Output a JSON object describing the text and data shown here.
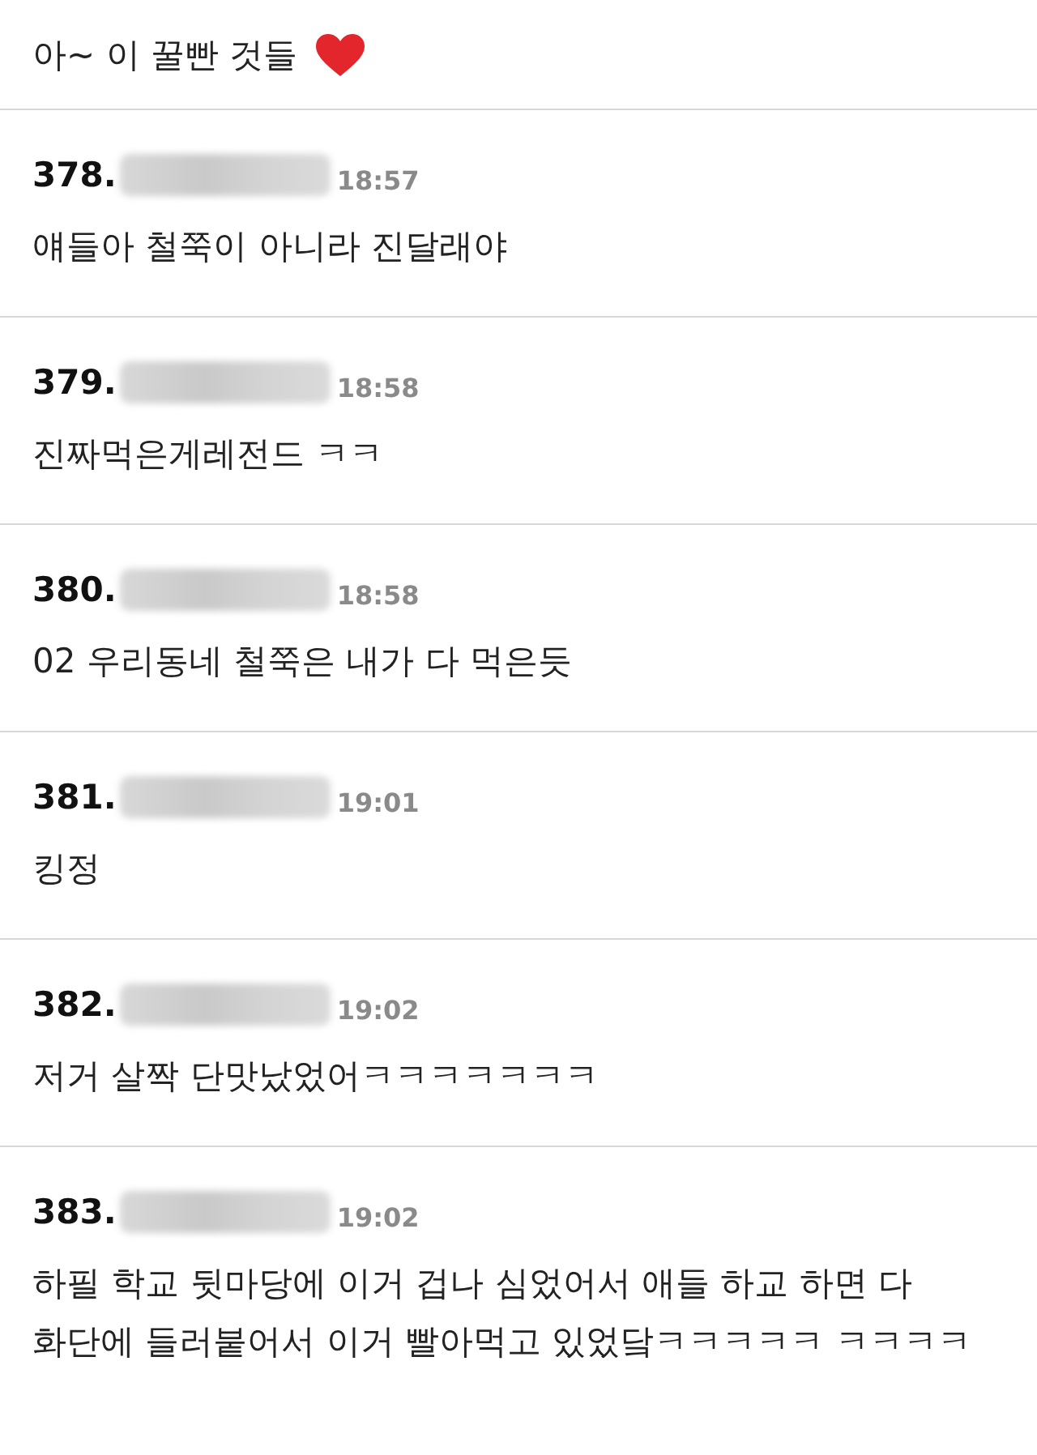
{
  "top_comment": {
    "text": "아~ 이 꿀빤 것들"
  },
  "comments": [
    {
      "number": "378.",
      "time": "18:57",
      "text": "얘들아 철쭉이 아니라 진달래야"
    },
    {
      "number": "379.",
      "time": "18:58",
      "text": "진짜먹은게레전드 ㅋㅋ"
    },
    {
      "number": "380.",
      "time": "18:58",
      "text": "02 우리동네 철쭉은 내가 다 먹은듯"
    },
    {
      "number": "381.",
      "time": "19:01",
      "text": "킹정"
    },
    {
      "number": "382.",
      "time": "19:02",
      "text": "저거 살짝 단맛났었어ㅋㅋㅋㅋㅋㅋㅋ"
    },
    {
      "number": "383.",
      "time": "19:02",
      "text": "하필 학교 뒷마당에 이거 겁나 심었어서 애들 하교 하면 다 화단에 들러붙어서 이거 빨아먹고 있었닼ㅋㅋㅋㅋㅋ ㅋㅋㅋㅋ"
    }
  ]
}
